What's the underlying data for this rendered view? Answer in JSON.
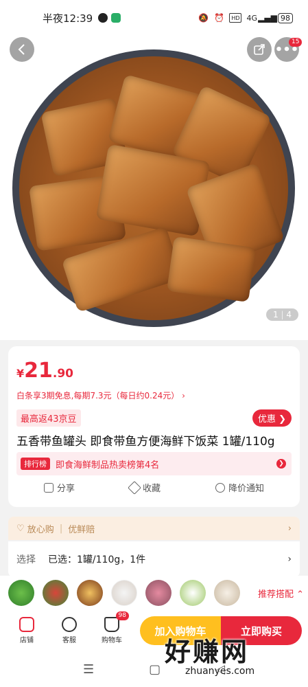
{
  "status_bar": {
    "time": "半夜12:39",
    "network": "4G",
    "battery": "98"
  },
  "nav": {
    "back_icon": "chevron-left-icon",
    "share_icon": "share-icon",
    "more_icon": "more-icon",
    "message_badge": "15"
  },
  "gallery": {
    "current": "1",
    "total": "4"
  },
  "product": {
    "currency": "¥",
    "price_int": "21",
    "price_dec": ".90",
    "installment": "白条享3期免息,每期7.3元（每日约0.24元） ›",
    "cashback": "最高返43京豆",
    "coupon_btn": "优惠 ❯",
    "title": "五香带鱼罐头 即食带鱼方便海鲜下饭菜 1罐/110g",
    "rank_tag": "排行榜",
    "rank_text": "即食海鲜制品热卖榜第4名"
  },
  "actions": {
    "share": "分享",
    "favorite": "收藏",
    "price_alert": "降价通知"
  },
  "guarantee": {
    "label": "放心购",
    "item": "优鲜赔",
    "chevron": "›"
  },
  "selection": {
    "label": "选择",
    "value": "已选：1罐/110g，1件",
    "chevron": "›"
  },
  "recommend": {
    "label": "推荐搭配 ⌃"
  },
  "bottom": {
    "store": "店铺",
    "service": "客服",
    "cart": "购物车",
    "cart_badge": "98",
    "add_to_cart": "加入购物车",
    "buy_now": "立即购买"
  },
  "watermark": {
    "big": "好赚网",
    "small": "zhuanyes.com"
  },
  "colors": {
    "accent": "#e8283c",
    "cart_button": "#ffbf1f",
    "guarantee_bg": "#fbeee1"
  }
}
